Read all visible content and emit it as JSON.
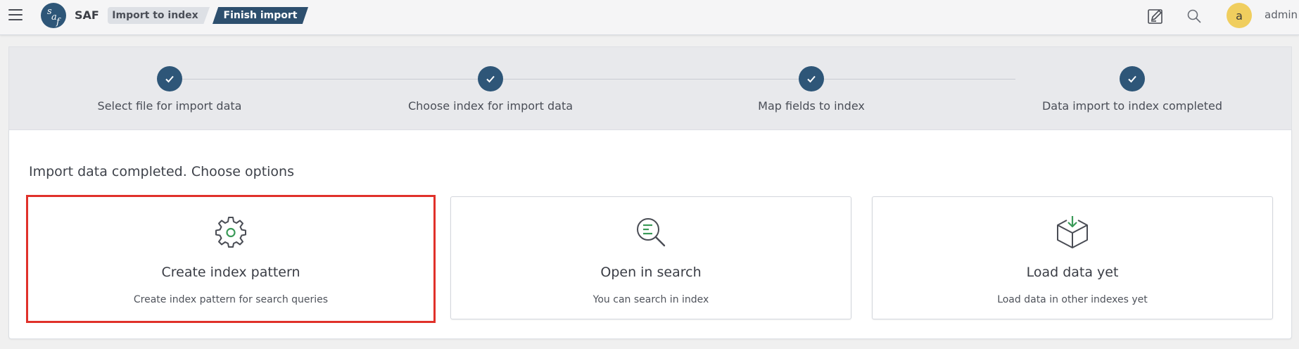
{
  "header": {
    "menu_icon": "hamburger-menu-icon",
    "logo_icon": "saf-logo-icon",
    "logo_text": "saf",
    "app_name": "SAF",
    "breadcrumbs": [
      {
        "label": "Import to index"
      },
      {
        "label": "Finish import"
      }
    ],
    "actions": [
      {
        "icon": "edit-note-icon"
      },
      {
        "icon": "search-icon"
      }
    ],
    "user": {
      "avatar_letter": "a",
      "avatar_color": "#f0ce5e",
      "name": "admin"
    }
  },
  "steps": [
    {
      "label": "Select file for import data",
      "status": "completed",
      "icon": "check-icon"
    },
    {
      "label": "Choose index for import data",
      "status": "completed",
      "icon": "check-icon"
    },
    {
      "label": "Map fields to index",
      "status": "completed",
      "icon": "check-icon"
    },
    {
      "label": "Data import to index completed",
      "status": "completed",
      "icon": "check-icon"
    }
  ],
  "content": {
    "title": "Import data completed. Choose options",
    "options": [
      {
        "icon": "gear-icon",
        "title": "Create index pattern",
        "description": "Create index pattern for search queries",
        "selected": true
      },
      {
        "icon": "document-search-icon",
        "title": "Open in search",
        "description": "You can search in index",
        "selected": false
      },
      {
        "icon": "box-download-icon",
        "title": "Load data yet",
        "description": "Load data in other indexes yet",
        "selected": false
      }
    ]
  },
  "colors": {
    "brand": "#2e5678",
    "accent_green": "#3a9a58",
    "selection_border": "#e0312a",
    "breadcrumb_active": "#2d4f6e"
  }
}
